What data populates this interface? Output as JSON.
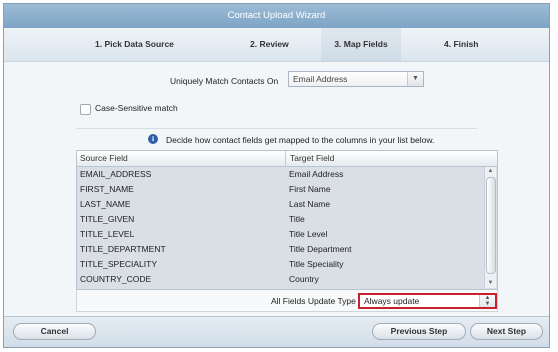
{
  "window": {
    "title": "Contact Upload Wizard"
  },
  "steps": [
    {
      "label": "1. Pick Data Source",
      "active": false
    },
    {
      "label": "2. Review",
      "active": false
    },
    {
      "label": "3. Map Fields",
      "active": true
    },
    {
      "label": "4. Finish",
      "active": false
    }
  ],
  "match": {
    "label": "Uniquely Match Contacts On",
    "value": "Email Address"
  },
  "case_sensitive": {
    "label": "Case-Sensitive match",
    "checked": false
  },
  "info": {
    "text": "Decide how contact fields get mapped to the columns in your list below."
  },
  "table": {
    "headers": [
      "Source Field",
      "Target Field"
    ],
    "rows": [
      [
        "EMAIL_ADDRESS",
        "Email Address"
      ],
      [
        "FIRST_NAME",
        "First Name"
      ],
      [
        "LAST_NAME",
        "Last Name"
      ],
      [
        "TITLE_GIVEN",
        "Title"
      ],
      [
        "TITLE_LEVEL",
        "Title Level"
      ],
      [
        "TITLE_DEPARTMENT",
        "Title Department"
      ],
      [
        "TITLE_SPECIALITY",
        "Title Speciality"
      ],
      [
        "COUNTRY_CODE",
        "Country"
      ]
    ]
  },
  "update_type": {
    "label": "All Fields Update Type",
    "value": "Always update"
  },
  "buttons": {
    "cancel": "Cancel",
    "previous": "Previous Step",
    "next": "Next Step"
  },
  "colors": {
    "highlight_border": "#c8202f",
    "title_bar": "#8fb2d0"
  }
}
